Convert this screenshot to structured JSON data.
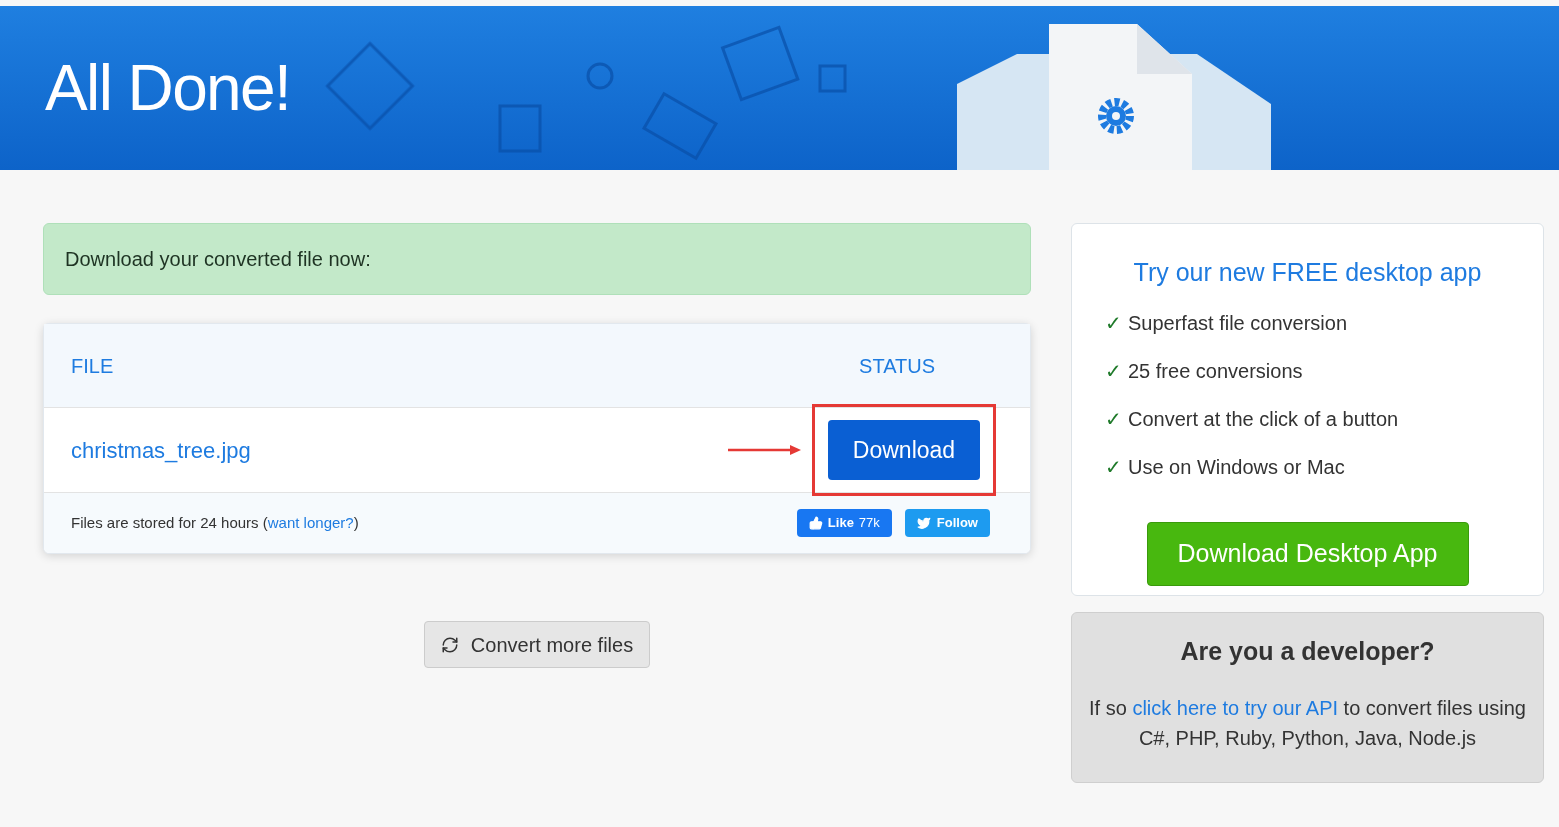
{
  "banner": {
    "title": "All Done!"
  },
  "notice": "Download your converted file now:",
  "files_table": {
    "columns": [
      "FILE",
      "STATUS"
    ],
    "rows": [
      {
        "name": "christmas_tree.jpg",
        "action": "Download",
        "highlighted": true
      }
    ],
    "footer": {
      "before": "Files are stored for 24 hours (",
      "link": "want longer?",
      "after": ")"
    },
    "social": {
      "like_label": "Like",
      "like_count": "77k",
      "follow": "Follow"
    }
  },
  "convert_more": "Convert more files",
  "desktop_app": {
    "title": "Try our new FREE desktop app",
    "features": [
      {
        "check": "✓",
        "text": "Superfast file conversion"
      },
      {
        "check": "✓",
        "text": "25 free conversions"
      },
      {
        "check": "✓",
        "text": "Convert at the click of a button"
      },
      {
        "check": "✓",
        "text": "Use on Windows or Mac"
      }
    ],
    "button": "Download Desktop App"
  },
  "developer": {
    "title": "Are you a developer?",
    "before": "If so ",
    "link": "click here to try our API",
    "after": " to convert files using C#, PHP, Ruby, Python, Java, Node.js"
  }
}
